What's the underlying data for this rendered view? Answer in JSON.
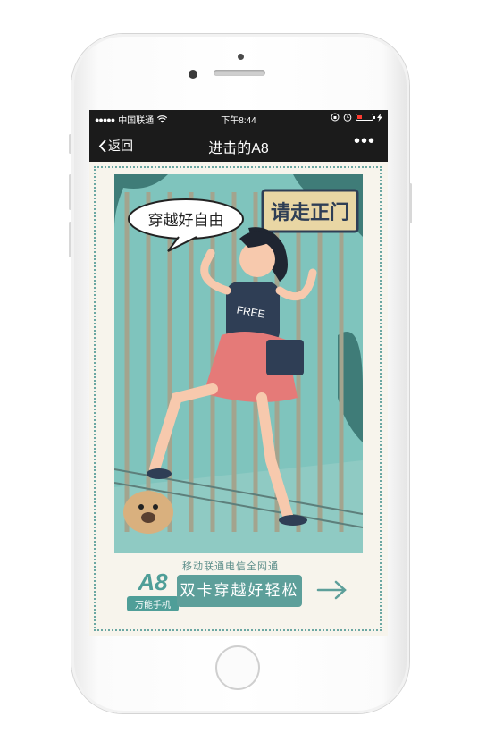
{
  "status_bar": {
    "signal_dots": "●●●●●",
    "carrier": "中国联通",
    "wifi_icon": "wifi-icon",
    "time": "下午8:44",
    "battery_level": 0.2,
    "battery_color": "#ff3b30"
  },
  "nav": {
    "back_label": "返回",
    "title": "进击的A8",
    "more_label": "•••"
  },
  "illustration": {
    "speech_bubble": "穿越好自由",
    "sign_text": "请走正门",
    "shirt_text": "FREE"
  },
  "promo": {
    "network_line": "移动联通电信全网通",
    "brand_logo": "A8",
    "brand_sub": "万能手机",
    "cta_label": "双卡穿越好轻松"
  },
  "colors": {
    "teal": "#5d9f9a",
    "dark_teal": "#3f7c78",
    "fence": "#a3a48e",
    "skirt": "#e57a78"
  }
}
